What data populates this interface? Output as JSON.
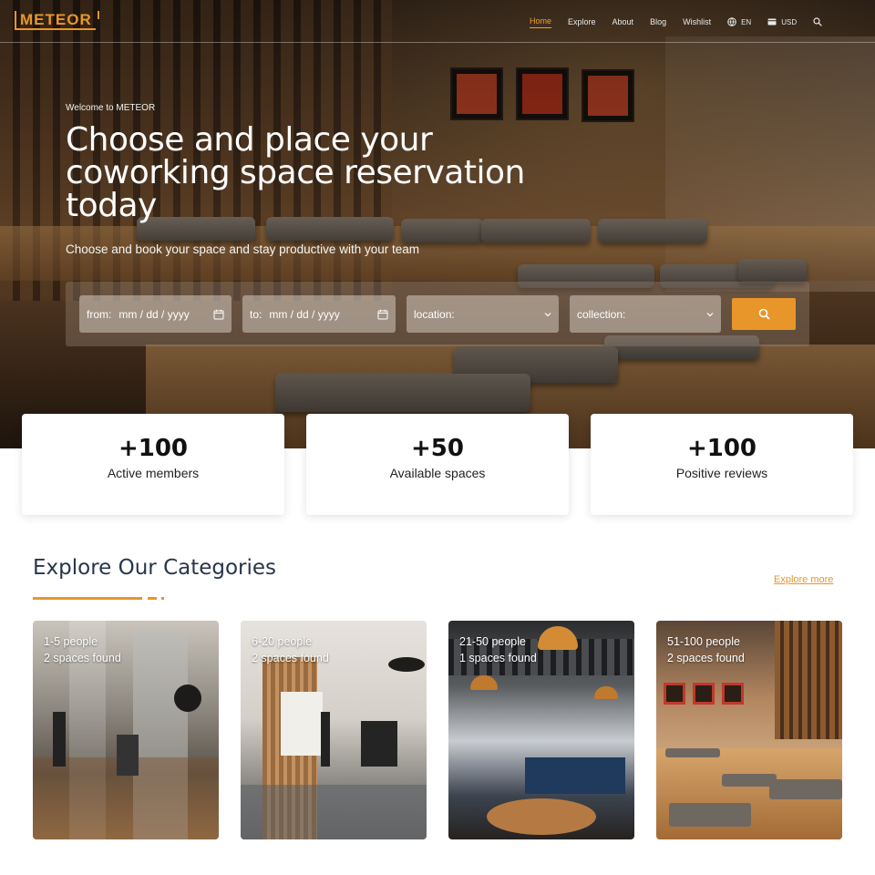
{
  "brand": {
    "logo_text": "METEOR",
    "accent_color": "#e8962a"
  },
  "nav": {
    "links": [
      {
        "label": "Home",
        "active": true
      },
      {
        "label": "Explore",
        "active": false
      },
      {
        "label": "About",
        "active": false
      },
      {
        "label": "Blog",
        "active": false
      },
      {
        "label": "Wishlist",
        "active": false
      }
    ],
    "language": {
      "label": "EN",
      "icon": "globe-icon"
    },
    "currency": {
      "label": "USD",
      "icon": "card-icon"
    },
    "search_icon": "search-icon"
  },
  "hero": {
    "welcome": "Welcome to METEOR",
    "headline": "Choose and place your coworking space reservation today",
    "subline": "Choose and book your space and stay productive with your team"
  },
  "search": {
    "from_label": "from:",
    "from_value": "mm / dd / yyyy",
    "to_label": "to:",
    "to_value": "mm / dd / yyyy",
    "location_placeholder": "location:",
    "collection_placeholder": "collection:",
    "button_icon": "search-icon"
  },
  "stats": [
    {
      "value": "+100",
      "label": "Active members"
    },
    {
      "value": "+50",
      "label": "Available spaces"
    },
    {
      "value": "+100",
      "label": "Positive reviews"
    }
  ],
  "categories": {
    "title": "Explore Our Categories",
    "explore_more": "Explore more",
    "items": [
      {
        "people": "1-5 people",
        "found": "2 spaces found"
      },
      {
        "people": "6-20 people",
        "found": "2 spaces found"
      },
      {
        "people": "21-50 people",
        "found": "1 spaces found"
      },
      {
        "people": "51-100 people",
        "found": "2 spaces found"
      }
    ]
  }
}
